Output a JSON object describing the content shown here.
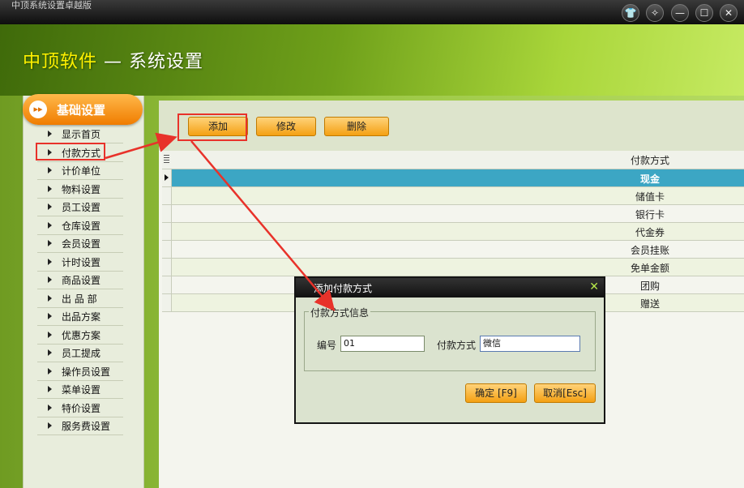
{
  "window": {
    "title": "中顶系统设置卓越版"
  },
  "header": {
    "brand": "中顶软件",
    "separator": " — ",
    "subtitle": "系统设置"
  },
  "sidebar": {
    "heading": "基础设置",
    "items": [
      "显示首页",
      "付款方式",
      "计价单位",
      "物料设置",
      "员工设置",
      "仓库设置",
      "会员设置",
      "计时设置",
      "商品设置",
      "出 品 部",
      "出品方案",
      "优惠方案",
      "员工提成",
      "操作员设置",
      "菜单设置",
      "特价设置",
      "服务费设置"
    ],
    "selected_index": 1
  },
  "toolbar": {
    "add_label": "添加",
    "edit_label": "修改",
    "delete_label": "删除"
  },
  "grid": {
    "column_header": "付款方式",
    "rows": [
      "现金",
      "储值卡",
      "银行卡",
      "代金券",
      "会员挂账",
      "免单金额",
      "团购",
      "赠送"
    ],
    "selected_row": 0
  },
  "dialog": {
    "title": "添加付款方式",
    "close_glyph": "✕",
    "group_label": "付款方式信息",
    "code_label": "编号",
    "code_value": "01",
    "method_label": "付款方式",
    "method_value": "微信",
    "ok_label": "确定 [F9]",
    "cancel_label": "取消[Esc]"
  },
  "colors": {
    "accent_orange": "#f4a013",
    "selection_blue": "#3ca6c4",
    "annotation_red": "#e8322a"
  }
}
